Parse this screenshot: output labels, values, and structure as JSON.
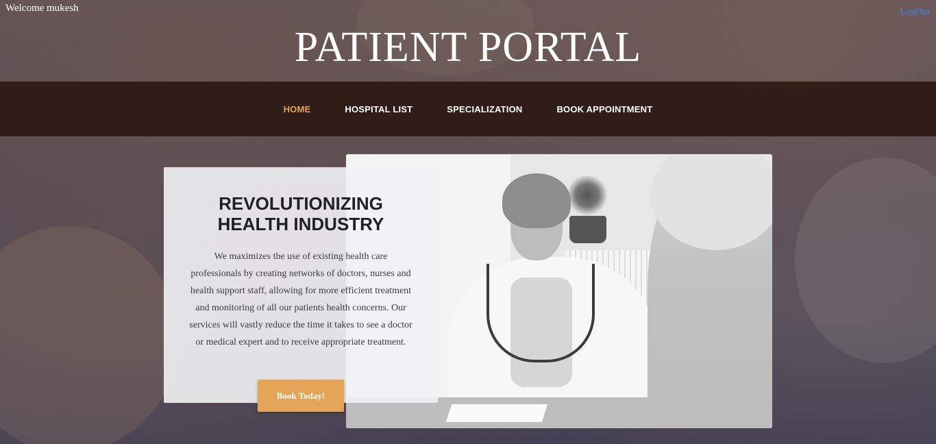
{
  "header": {
    "welcome_text": "Welcome mukesh",
    "logout_label": "LogOut",
    "site_title": "PATIENT PORTAL"
  },
  "nav": {
    "items": [
      {
        "label": "HOME",
        "active": true
      },
      {
        "label": "HOSPITAL LIST",
        "active": false
      },
      {
        "label": "SPECIALIZATION",
        "active": false
      },
      {
        "label": "BOOK APPOINTMENT",
        "active": false
      }
    ]
  },
  "hero": {
    "heading_line1": "REVOLUTIONIZING",
    "heading_line2": "HEALTH INDUSTRY",
    "body": "We maximizes the use of existing health care professionals by creating networks of doctors, nurses and health support staff, allowing for more efficient treatment and monitoring of all our patients health concerns. Our services will vastly reduce the time it takes to see a doctor or medical expert and to receive appropriate treatment.",
    "cta_label": "Book Today!",
    "image_subject": "doctor-consultation-photo"
  },
  "colors": {
    "accent": "#e3a458",
    "nav_bg": "#2d1912",
    "link": "#3b82f6",
    "card_bg": "#f2f2f4",
    "heading_text": "#1f1f26"
  }
}
